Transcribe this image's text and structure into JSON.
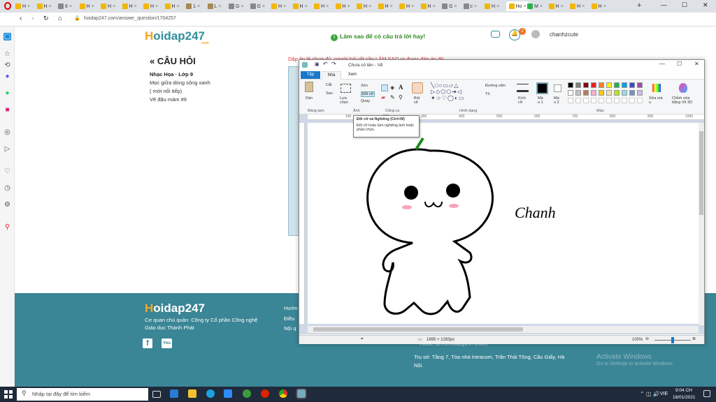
{
  "browser": {
    "url": "hoidap247.com/answer_question/1704257",
    "active_tab": "Ho",
    "tabs": [
      "H",
      "H",
      "6",
      "H",
      "H",
      "H",
      "H",
      "H",
      "1",
      "L",
      "G",
      "G",
      "H",
      "H",
      "H",
      "H",
      "H",
      "H",
      "H",
      "H",
      "G",
      "c",
      "H",
      "Ho",
      "M",
      "H",
      "H",
      "H"
    ]
  },
  "site": {
    "logo": "Hoidap247",
    "logo_first": "H",
    "logo_rest": "oidap247",
    "logo_com": ".com",
    "hint": "Làm sao để có câu trả lời hay!",
    "notif_count": "2",
    "username": "chanhzcute"
  },
  "question": {
    "header": "CÂU HỎI",
    "subject": "Nhạc Họa · Lớp 9",
    "line1": "Mọc giữa dòng sông xanh",
    "line2": "( mới nối tiếp)",
    "line3": "Vẽ đậu màm #9",
    "answer_peek": "Dập ản lẻ chưa đủ, người hỏi rất cần LÀM SAO ra được đáp án đó"
  },
  "footer": {
    "logo": "Hoidap247",
    "owner_line1": "Cơ quan chủ quản: Công ty Cổ phần Công nghệ",
    "owner_line2": "Giáo dục Thành Phát",
    "link1": "Hướn",
    "link2": "Điều",
    "link3": "Nội q",
    "email": "Inbox: fb.me/hoidap247online",
    "address1": "Trụ sở: Tầng 7, Tòa nhà Intracom, Trần Thái Tông, Cầu Giấy, Hà",
    "address2": "Nội.",
    "watermark1": "Activate Windows",
    "watermark2": "Go to Settings to activate Windows."
  },
  "paint": {
    "title": "Chưa có tên - Vẽ",
    "tabs": [
      "Tệp",
      "Nhà",
      "Xem"
    ],
    "groups": [
      "Bảng tạm",
      "Ảnh",
      "Công cụ",
      "Hình dạng",
      "Màu"
    ],
    "clipboard": {
      "paste": "Dán",
      "cut": "Cắt",
      "copy": "Sao"
    },
    "image": {
      "select": "Lựa chọn",
      "crop": "Xén",
      "resize": "Đổi cỡ",
      "rotate": "Quay"
    },
    "brush": "Bút vẽ",
    "outline": "Đường viền",
    "fill": "Tô",
    "size": "Kích cỡ",
    "color1": "Mà u 1",
    "color2": "Mà u 2",
    "edit_colors": "Sửa mà u",
    "edit_paint3d": "Chỉnh sửa bằng Vẽ 3D",
    "ruler": [
      "100",
      "200",
      "300",
      "400",
      "500",
      "600",
      "700",
      "800",
      "900",
      "1000"
    ],
    "tooltip_title": "Đổi cỡ và Nghiêng (Ctrl+W)",
    "tooltip_body": "Đổi cỡ hoặc làm nghiêng ảnh hoặc phần chọn.",
    "canvas_text": "Chanh",
    "status_size": "1895 × 1283px",
    "zoom": "100%",
    "palette": [
      "#000000",
      "#7f7f7f",
      "#880015",
      "#ed1c24",
      "#ff7f27",
      "#fff200",
      "#22b14c",
      "#00a2e8",
      "#3f48cc",
      "#a349a4",
      "#ffffff",
      "#c3c3c3",
      "#b97a57",
      "#ffaec9",
      "#ffc90e",
      "#efe4b0",
      "#b5e61d",
      "#99d9ea",
      "#7092be",
      "#c8bfe7"
    ]
  },
  "taskbar": {
    "search_placeholder": "Nhập tại đây để tìm kiếm",
    "lang": "VIE",
    "time": "9:04 CH",
    "date": "18/01/2021"
  }
}
